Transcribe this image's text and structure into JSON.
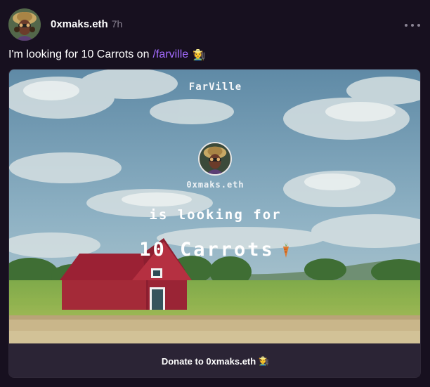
{
  "post": {
    "author": {
      "username": "0xmaks.eth",
      "avatar_icon": "avatar-farmer-portrait"
    },
    "timestamp": "7h",
    "more_icon": "ellipsis-icon",
    "text_main": "I'm looking for 10 Carrots on",
    "channel": "/farville",
    "text_emoji": "🧑‍🌾"
  },
  "embed": {
    "title": "FarVille",
    "username": "0xmaks.eth",
    "looking_text": "is looking for",
    "item_text": "10 Carrots",
    "item_icon": "carrot-icon",
    "button_label": "Donate to 0xmaks.eth",
    "button_emoji": "🧑‍🌾"
  },
  "colors": {
    "background": "#17101f",
    "channel_link": "#a36bff",
    "muted_text": "#8b8494",
    "button_bg": "#2b2435",
    "barn_red": "#9b2134"
  }
}
